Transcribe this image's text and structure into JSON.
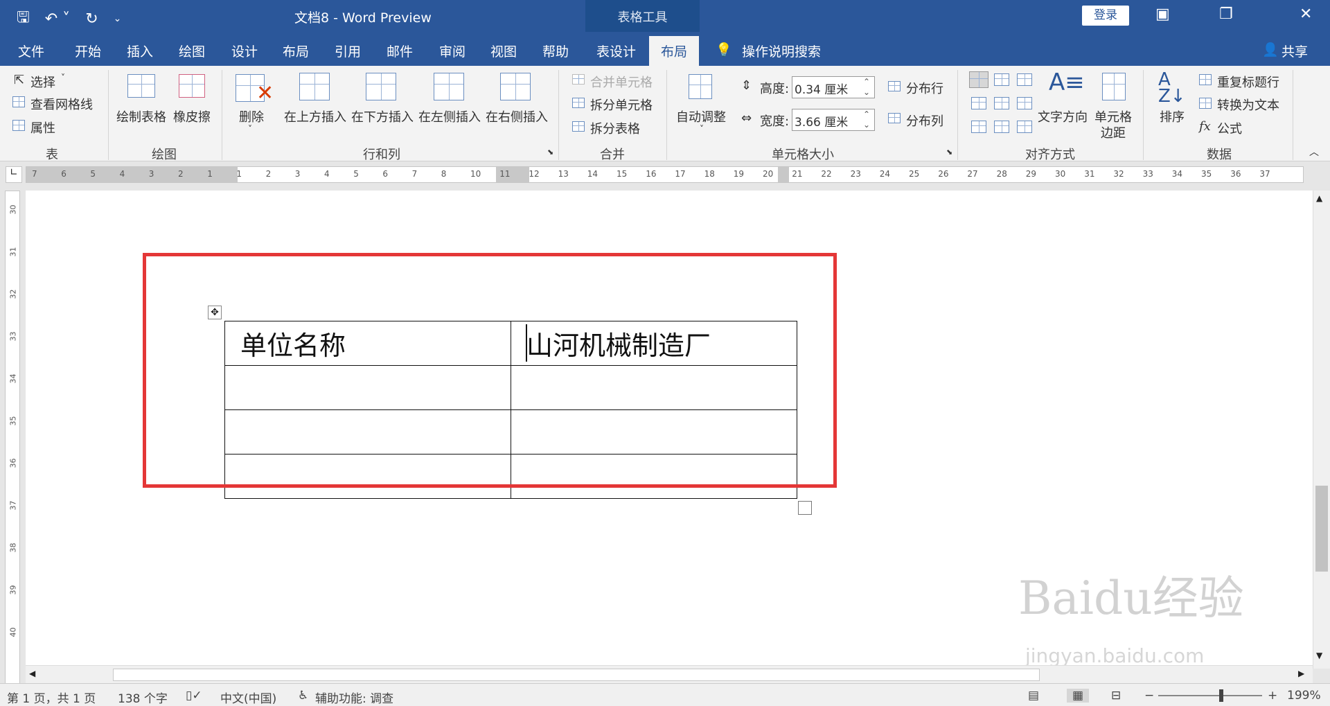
{
  "titlebar": {
    "doc_title": "文档8  -  Word Preview",
    "tools_label": "表格工具",
    "login": "登录"
  },
  "tabs": [
    "文件",
    "开始",
    "插入",
    "绘图",
    "设计",
    "布局",
    "引用",
    "邮件",
    "审阅",
    "视图",
    "帮助",
    "表设计"
  ],
  "active_tab": "布局",
  "tell_me": "操作说明搜索",
  "share": "共享",
  "ribbon": {
    "table_group": {
      "label": "表",
      "select": "选择",
      "gridlines": "查看网格线",
      "properties": "属性"
    },
    "draw_group": {
      "label": "绘图",
      "draw_table": "绘制表格",
      "eraser": "橡皮擦"
    },
    "rows_cols_group": {
      "label": "行和列",
      "delete": "删除",
      "insert_above": "在上方插入",
      "insert_below": "在下方插入",
      "insert_left": "在左侧插入",
      "insert_right": "在右侧插入"
    },
    "merge_group": {
      "label": "合并",
      "merge_cells": "合并单元格",
      "split_cells": "拆分单元格",
      "split_table": "拆分表格"
    },
    "cell_size_group": {
      "label": "单元格大小",
      "autofit": "自动调整",
      "height_label": "高度:",
      "height_value": "0.34 厘米",
      "width_label": "宽度:",
      "width_value": "3.66 厘米",
      "distribute_rows": "分布行",
      "distribute_cols": "分布列"
    },
    "alignment_group": {
      "label": "对齐方式",
      "text_direction": "文字方向",
      "cell_margins_line1": "单元格",
      "cell_margins_line2": "边距"
    },
    "data_group": {
      "label": "数据",
      "sort": "排序",
      "repeat_header": "重复标题行",
      "convert_text": "转换为文本",
      "formula": "公式"
    }
  },
  "ruler_labels": [
    "7",
    "6",
    "5",
    "4",
    "3",
    "2",
    "1",
    "1",
    "2",
    "3",
    "4",
    "5",
    "6",
    "7",
    "8",
    "10",
    "11",
    "12",
    "13",
    "14",
    "15",
    "16",
    "17",
    "18",
    "19",
    "20",
    "21",
    "22",
    "23",
    "24",
    "25",
    "26",
    "27",
    "28",
    "29",
    "30",
    "31",
    "32",
    "33",
    "34",
    "35",
    "36",
    "37"
  ],
  "vruler_labels": [
    "30",
    "31",
    "32",
    "33",
    "34",
    "35",
    "36",
    "37",
    "38",
    "39",
    "40"
  ],
  "document": {
    "table": [
      [
        "单位名称",
        "山河机械制造厂"
      ],
      [
        "",
        ""
      ],
      [
        "",
        ""
      ],
      [
        "",
        ""
      ]
    ]
  },
  "status": {
    "page": "第 1 页，共 1 页",
    "words": "138 个字",
    "language": "中文(中国)",
    "accessibility": "辅助功能: 调查",
    "zoom": "199%"
  },
  "watermark": {
    "brand": "Baidu经验",
    "url": "jingyan.baidu.com"
  }
}
